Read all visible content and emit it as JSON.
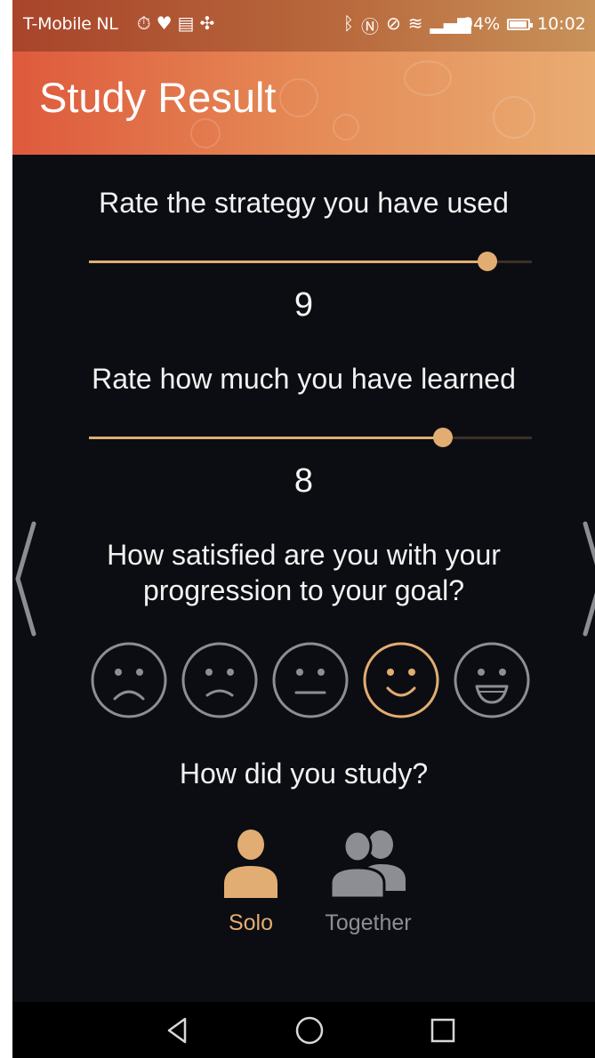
{
  "status_bar": {
    "carrier": "T-Mobile NL",
    "battery_percent": "94%",
    "time": "10:02"
  },
  "header": {
    "title": "Study Result"
  },
  "strategy_rating": {
    "question": "Rate the strategy you have used",
    "value": "9",
    "fill_fraction": 0.9
  },
  "learned_rating": {
    "question": "Rate how much you have learned",
    "value": "8",
    "fill_fraction": 0.8
  },
  "satisfaction": {
    "question_line1": "How satisfied are you with your",
    "question_line2": "progression to your goal?",
    "options": [
      "very-sad-face-icon",
      "sad-face-icon",
      "neutral-face-icon",
      "happy-face-icon",
      "very-happy-face-icon"
    ],
    "selected_index": 3
  },
  "study_mode": {
    "question": "How did you study?",
    "options": [
      {
        "label": "Solo",
        "icon": "single-person-icon",
        "selected": true
      },
      {
        "label": "Together",
        "icon": "group-people-icon",
        "selected": false
      }
    ]
  },
  "colors": {
    "accent": "#e2ad72",
    "inactive": "#8d8e93",
    "background": "#0c0d12"
  }
}
